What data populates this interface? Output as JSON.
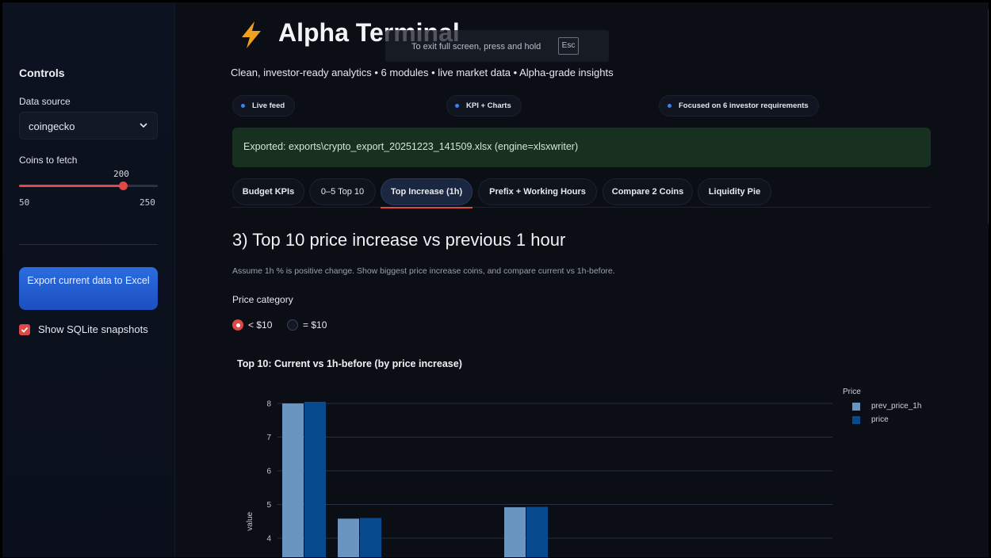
{
  "sidebar": {
    "title": "Controls",
    "data_source_label": "Data source",
    "data_source_value": "coingecko",
    "coins_label": "Coins to fetch",
    "coins_value": "200",
    "coins_min": "50",
    "coins_max": "250",
    "coins_level": 0.75,
    "export_button": "Export current data to Excel",
    "sqlite_checkbox": "Show SQLite snapshots",
    "sqlite_checked": true
  },
  "header": {
    "title": "Alpha Terminal",
    "subtitle": "Clean, investor-ready analytics • 6 modules • live market data • Alpha-grade insights",
    "fullscreen_hint": "To exit full screen, press and hold",
    "fullscreen_key": "Esc"
  },
  "pills": [
    "Live feed",
    "KPI + Charts",
    "Focused on 6 investor requirements"
  ],
  "success_message": "Exported: exports\\crypto_export_20251223_141509.xlsx (engine=xlsxwriter)",
  "tabs": [
    "Budget KPIs",
    "0–5 Top 10",
    "Top Increase (1h)",
    "Prefix + Working Hours",
    "Compare 2 Coins",
    "Liquidity Pie"
  ],
  "active_tab": 2,
  "section": {
    "heading": "3) Top 10 price increase vs previous 1 hour",
    "caption": "Assume 1h % is positive change. Show biggest price increase coins, and compare current vs 1h-before.",
    "price_category_label": "Price category",
    "options": [
      "< $10",
      "= $10"
    ],
    "selected_option": 0
  },
  "colors": {
    "accent_red": "#e04848",
    "prev_price_color": "#6a95c0",
    "price_color": "#084a8e",
    "success_bg": "#17301f"
  },
  "chart_data": {
    "type": "bar",
    "title": "Top 10: Current vs 1h-before (by price increase)",
    "ylabel": "value",
    "legend_title": "Price",
    "legend_position": "top-right",
    "ylim_visible": [
      3.3,
      8.6
    ],
    "yticks": [
      4,
      5,
      6,
      7,
      8
    ],
    "series": [
      {
        "name": "prev_price_1h",
        "values": [
          8.0,
          4.58,
          null,
          null,
          4.92
        ]
      },
      {
        "name": "price",
        "values": [
          8.05,
          4.6,
          null,
          null,
          4.93
        ]
      }
    ],
    "grid": true
  }
}
